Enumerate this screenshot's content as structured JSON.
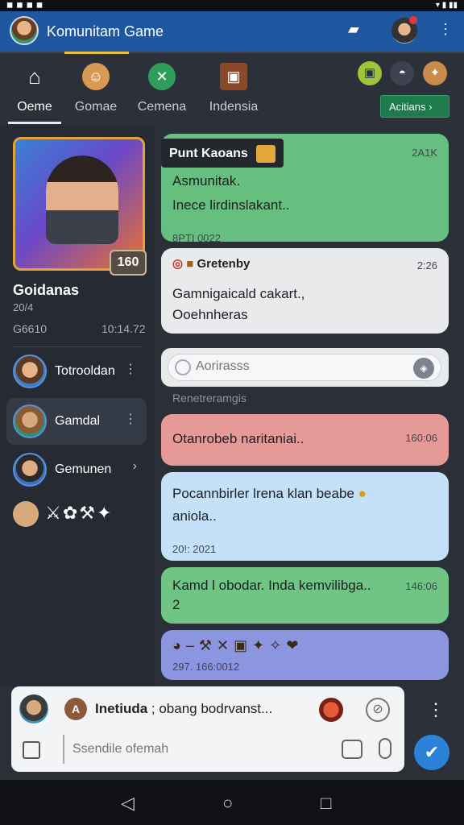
{
  "appbar": {
    "title": "Komunitam Game",
    "icons": [
      "map-icon",
      "user-avatar",
      "more-vert-icon"
    ]
  },
  "tabs": [
    {
      "label": "Oeme",
      "icon": "home-icon",
      "active": true
    },
    {
      "label": "Gomae",
      "icon": "game-avatar-icon",
      "active": false
    },
    {
      "label": "Cemena",
      "icon": "controller-icon",
      "active": false
    },
    {
      "label": "Indensia",
      "icon": "treasure-icon",
      "active": false
    }
  ],
  "actions_button": {
    "label": "Acitians"
  },
  "profile": {
    "name": "Goidanas",
    "level": "160",
    "stat1": "20/4",
    "stat2": "G6610",
    "stat3": "10:14.72"
  },
  "friends": [
    {
      "name": "Totrooldan"
    },
    {
      "name": "Gamdal"
    },
    {
      "name": "Gemunen"
    }
  ],
  "messages": {
    "m1": {
      "header": "Punt Kaoans",
      "time": "2A1K",
      "lines": [
        "Asmunitak.",
        "Inece lirdinslakant.."
      ],
      "footer": "8PTI 0022"
    },
    "m2": {
      "user": "Gretenby",
      "time": "2:26",
      "lines": [
        "Gamnigaicald cakart.,",
        "Ooehnheras"
      ]
    },
    "search_placeholder": "Aorirasss",
    "system_note": "Renetreramgis",
    "m3": {
      "text": "Otanrobeb naritaniai..",
      "time": "160:06"
    },
    "m4": {
      "lines": [
        "Pocannbirler lrena klan beabe",
        "aniola.."
      ],
      "footer": "20!: 2021"
    },
    "m5": {
      "lines": [
        "Kamd l obodar. Inda kemvilibga..",
        "2"
      ],
      "time": "146:06"
    },
    "m6": {
      "footer": "297. 166:0012"
    }
  },
  "composer": {
    "tag": "A",
    "title_bold": "Inetiuda",
    "title_rest": "; obang bodrvanst...",
    "placeholder": "Ssendile ofemah"
  }
}
